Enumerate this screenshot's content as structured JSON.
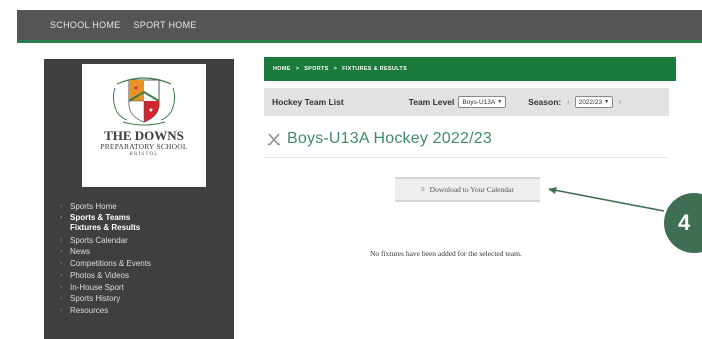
{
  "topnav": {
    "items": [
      "SCHOOL HOME",
      "SPORT HOME"
    ]
  },
  "school": {
    "name": "THE DOWNS",
    "subtitle": "PREPARATORY SCHOOL",
    "location": "BRISTOL",
    "crest_colors": {
      "orange": "#e8922a",
      "red": "#d0262c",
      "white": "#ffffff",
      "green": "#3a7d44"
    }
  },
  "sidebar": {
    "items": [
      {
        "label": "Sports Home"
      },
      {
        "label": "Sports & Teams",
        "label2": "Fixtures & Results",
        "active": true
      },
      {
        "label": "Sports Calendar"
      },
      {
        "label": "News"
      },
      {
        "label": "Competitions & Events"
      },
      {
        "label": "Photos & Videos"
      },
      {
        "label": "In-House Sport"
      },
      {
        "label": "Sports History"
      },
      {
        "label": "Resources"
      }
    ]
  },
  "breadcrumb": {
    "items": [
      "HOME",
      "SPORTS",
      "FIXTURES & RESULTS"
    ],
    "separator": ">"
  },
  "filters": {
    "list_label": "Hockey Team List",
    "team_level_label": "Team Level",
    "team_level_value": "Boys-U13A",
    "season_label": "Season:",
    "season_value": "2022/23"
  },
  "page_title": "Boys-U13A Hockey 2022/23",
  "download_label": "Download to Your Calendar",
  "empty_message": "No fixtures have been added for the selected team.",
  "step_badge": "4",
  "colors": {
    "accent_green": "#1a7a3c",
    "title_green": "#3f8f63",
    "badge": "#3f6f52"
  }
}
